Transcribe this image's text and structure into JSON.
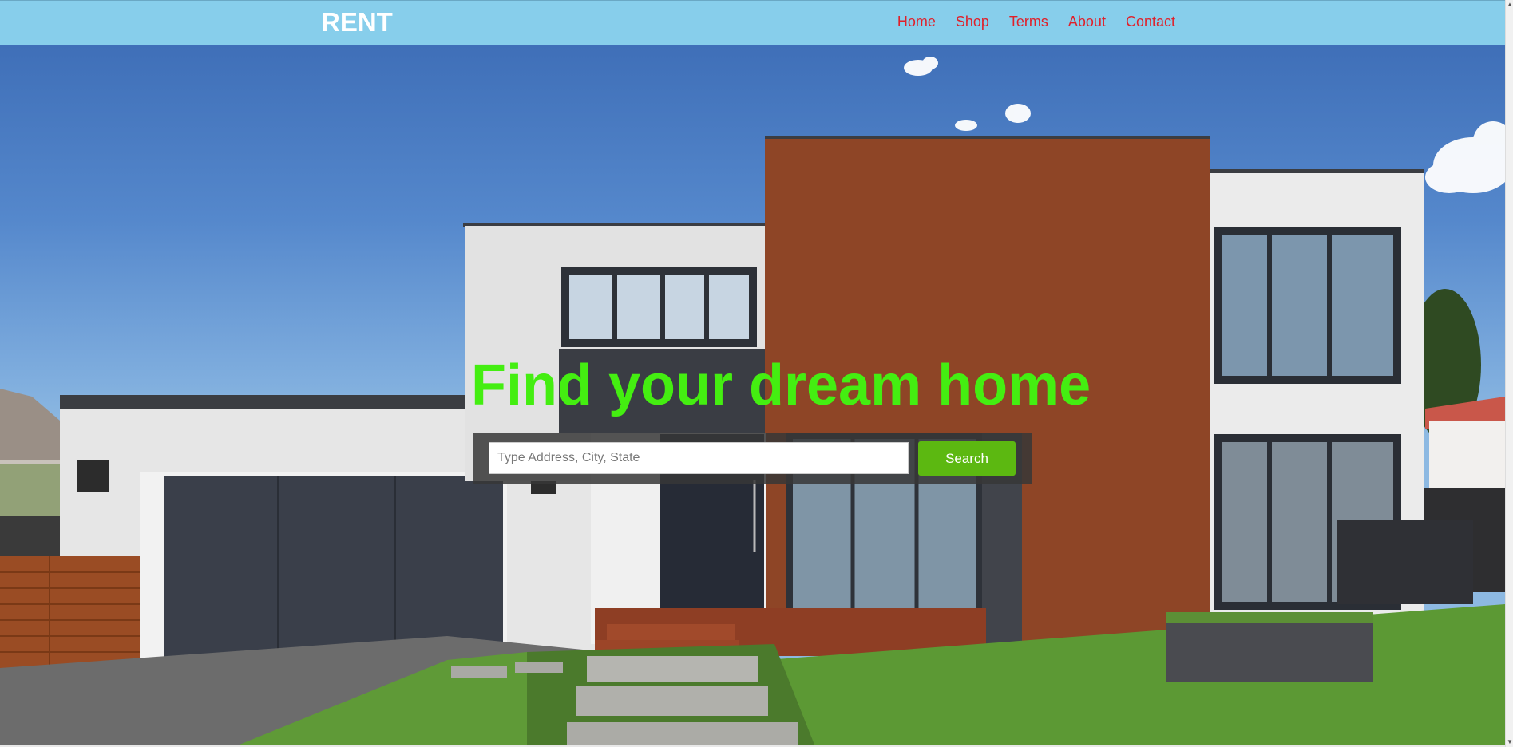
{
  "brand": "RENT",
  "nav": {
    "items": [
      "Home",
      "Shop",
      "Terms",
      "About",
      "Contact"
    ]
  },
  "hero": {
    "title": "Find your dream home",
    "search": {
      "placeholder": "Type Address, City, State",
      "value": "",
      "button_label": "Search"
    },
    "image_description": "modern-house-photo"
  },
  "colors": {
    "navbar_bg": "#87ceeb",
    "brand_text": "#ffffff",
    "nav_link": "#e0202a",
    "hero_title": "#44ee11",
    "search_button": "#5cb811"
  }
}
